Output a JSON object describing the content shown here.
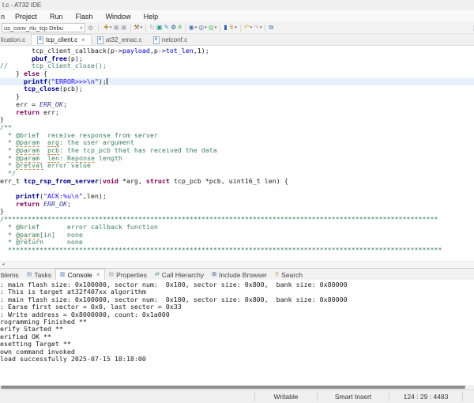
{
  "window": {
    "title": "t.c - AT32 IDE"
  },
  "menu_bar": {
    "items": [
      {
        "label": "n"
      },
      {
        "label": "Project"
      },
      {
        "label": "Run"
      },
      {
        "label": "Flash"
      },
      {
        "label": "Window"
      },
      {
        "label": "Help"
      }
    ]
  },
  "toolbar": {
    "launch_config_label": "us_conv_rtu_tcp Debu",
    "launch_chevron": "∨",
    "launch_gear_glyph": "⚙",
    "icons": [
      {
        "name": "new-wizard-icon",
        "glyph": "✚",
        "color": "#b8923a",
        "dropdown": true
      },
      {
        "name": "save-icon",
        "glyph": "▣",
        "color": "#aeb3b9"
      },
      {
        "name": "save-all-icon",
        "glyph": "▣",
        "color": "#aeb3b9"
      },
      {
        "sep": true
      },
      {
        "name": "build-icon",
        "glyph": "⚒",
        "color": "#8a6d3b",
        "dropdown": true
      },
      {
        "sep": true
      },
      {
        "name": "refresh-icon",
        "glyph": "↻",
        "color": "#aeb3b9"
      },
      {
        "name": "chip-icon",
        "glyph": "▣",
        "color": "#2a9d8f"
      },
      {
        "name": "erase-icon",
        "glyph": "✎",
        "color": "#4a90d9"
      },
      {
        "name": "settings-gear-icon",
        "glyph": "⚙",
        "color": "#2456a4"
      },
      {
        "name": "hash-icon",
        "glyph": "#",
        "color": "#3cb54a"
      },
      {
        "sep": true
      },
      {
        "name": "debug-icon",
        "glyph": "◉",
        "color": "#4a77b4",
        "dropdown": true
      },
      {
        "name": "run-icon",
        "glyph": "◎",
        "color": "#4a77b4",
        "dropdown": true
      },
      {
        "name": "external-tools-icon",
        "glyph": "◎",
        "color": "#3cb54a",
        "dropdown": true
      },
      {
        "sep": true
      },
      {
        "name": "target-board-icon",
        "glyph": "▮",
        "color": "#3a5fa8"
      },
      {
        "name": "flash-download-icon",
        "glyph": "↯",
        "color": "#c49a3c",
        "dropdown": true
      },
      {
        "sep": true
      },
      {
        "name": "back-icon",
        "glyph": "↶",
        "color": "#d6a930",
        "dropdown": true
      },
      {
        "name": "forward-icon",
        "glyph": "↷",
        "color": "#aeb3b9",
        "dropdown": true
      },
      {
        "sep": true
      },
      {
        "name": "perspective-icon",
        "glyph": "⧉",
        "color": "#4a77b4"
      }
    ],
    "right_clipped_icon_glyph": "▮"
  },
  "editor_tabs": [
    {
      "label": "lication.c"
    },
    {
      "label": "tcp_client.c",
      "active": true,
      "close": "×"
    },
    {
      "label": "at32_emac.c"
    },
    {
      "label": "netconf.c"
    }
  ],
  "editor": {
    "cursor_line": 4,
    "lines": [
      {
        "seg": [
          [
            "pl",
            "        tcp_client_callback(p->"
          ],
          [
            "fld",
            "payload"
          ],
          [
            "pl",
            ",p->"
          ],
          [
            "fld",
            "tot_len"
          ],
          [
            "pl",
            ",1);"
          ]
        ]
      },
      {
        "seg": [
          [
            "pl",
            "        "
          ],
          [
            "fnb",
            "pbuf_free"
          ],
          [
            "pl",
            "(p);"
          ]
        ]
      },
      {
        "seg": [
          [
            "cm",
            "//      tcp_client_close();"
          ]
        ]
      },
      {
        "seg": [
          [
            "pl",
            "    } "
          ],
          [
            "kw",
            "else"
          ],
          [
            "pl",
            " {"
          ]
        ]
      },
      {
        "seg": [
          [
            "pl",
            "      "
          ],
          [
            "fnb",
            "printf"
          ],
          [
            "pl",
            "("
          ],
          [
            "str",
            "\"ERROR>>>\\n\""
          ],
          [
            "pl",
            ");"
          ]
        ]
      },
      {
        "seg": [
          [
            "pl",
            "      "
          ],
          [
            "fnb",
            "tcp_close"
          ],
          [
            "pl",
            "(pcb);"
          ]
        ]
      },
      {
        "seg": [
          [
            "pl",
            "    }"
          ]
        ]
      },
      {
        "seg": [
          [
            "pl",
            "    err = "
          ],
          [
            "mac",
            "ERR_OK"
          ],
          [
            "pl",
            ";"
          ]
        ]
      },
      {
        "seg": [
          [
            "pl",
            "    "
          ],
          [
            "kw",
            "return"
          ],
          [
            "pl",
            " err;"
          ]
        ]
      },
      {
        "seg": [
          [
            "pl",
            "}"
          ]
        ]
      },
      {
        "seg": [
          [
            "cm",
            "/**"
          ]
        ]
      },
      {
        "seg": [
          [
            "cm",
            "  * "
          ],
          [
            "cmt",
            "@brief"
          ],
          [
            "cm",
            "  receive response from server"
          ]
        ]
      },
      {
        "seg": [
          [
            "cm",
            "  * "
          ],
          [
            "cmu",
            "@param"
          ],
          [
            "cm",
            "  "
          ],
          [
            "cmu",
            "arg"
          ],
          [
            "cm",
            ": the user argument"
          ]
        ]
      },
      {
        "seg": [
          [
            "cm",
            "  * "
          ],
          [
            "cmu",
            "@param"
          ],
          [
            "cm",
            "  "
          ],
          [
            "cmu",
            "pcb"
          ],
          [
            "cm",
            ": the tcp_pcb that has received the data"
          ]
        ]
      },
      {
        "seg": [
          [
            "cm",
            "  * "
          ],
          [
            "cmu",
            "@param"
          ],
          [
            "cm",
            "  "
          ],
          [
            "cmu",
            "len"
          ],
          [
            "cm",
            ": "
          ],
          [
            "cmu",
            "Reponse"
          ],
          [
            "cm",
            " length"
          ]
        ]
      },
      {
        "seg": [
          [
            "cm",
            "  * "
          ],
          [
            "cmu",
            "@retval"
          ],
          [
            "cm",
            " error value"
          ]
        ]
      },
      {
        "seg": [
          [
            "cm",
            "  */"
          ]
        ]
      },
      {
        "seg": [
          [
            "pl",
            "err_t "
          ],
          [
            "fnb",
            "tcp_rsp_from_server"
          ],
          [
            "pl",
            "("
          ],
          [
            "kw",
            "void"
          ],
          [
            "pl",
            " *arg, "
          ],
          [
            "kw",
            "struct"
          ],
          [
            "pl",
            " tcp_pcb *pcb, uint16_t len) {"
          ]
        ]
      },
      {
        "seg": []
      },
      {
        "seg": [
          [
            "pl",
            "    "
          ],
          [
            "fnb",
            "printf"
          ],
          [
            "pl",
            "("
          ],
          [
            "str",
            "\"ACK:%u\\n\""
          ],
          [
            "pl",
            ",len);"
          ]
        ]
      },
      {
        "seg": [
          [
            "pl",
            "    "
          ],
          [
            "kw",
            "return"
          ],
          [
            "pl",
            " "
          ],
          [
            "mac",
            "ERR_OK"
          ],
          [
            "pl",
            ";"
          ]
        ]
      },
      {
        "seg": [
          [
            "pl",
            "}"
          ]
        ]
      },
      {
        "seg": [
          [
            "cm",
            "/**************************************************************************************************************"
          ]
        ]
      },
      {
        "seg": [
          [
            "cm",
            "  * "
          ],
          [
            "cmt",
            "@brief"
          ],
          [
            "cm",
            "       error callback function"
          ]
        ]
      },
      {
        "seg": [
          [
            "cm",
            "  * "
          ],
          [
            "cmu",
            "@param"
          ],
          [
            "cm",
            "[in]   none"
          ]
        ]
      },
      {
        "seg": [
          [
            "cm",
            "  * "
          ],
          [
            "cmt",
            "@return"
          ],
          [
            "cm",
            "      none"
          ]
        ]
      },
      {
        "seg": [
          [
            "cm",
            "  **************************************************************************************************************"
          ]
        ]
      }
    ]
  },
  "console_panel": {
    "tabs": [
      {
        "label": "blems"
      },
      {
        "label": "Tasks",
        "icon_glyph": "▤",
        "icon_color": "#7d93b2"
      },
      {
        "label": "Console",
        "icon_glyph": "▥",
        "icon_color": "#4a77b4",
        "active": true,
        "close": "×"
      },
      {
        "label": "Properties",
        "icon_glyph": "▤",
        "icon_color": "#9aa0a6"
      },
      {
        "label": "Call Hierarchy",
        "icon_glyph": "⇄",
        "icon_color": "#3f8f6f"
      },
      {
        "label": "Include Browser",
        "icon_glyph": "⊞",
        "icon_color": "#30548f"
      },
      {
        "label": "Search",
        "icon_glyph": "⚲",
        "icon_color": "#c49a3c"
      }
    ],
    "lines": [
      ": main flash size: 0x100000, sector num:  0x100, sector size: 0x800,  bank size: 0x80000",
      ": This is target at32f407xx algorithm",
      ": main flash size: 0x100000, sector num:  0x100, sector size: 0x800,  bank size: 0x80000",
      ": Earse first sector = 0x0, last sector = 0x33",
      ": Write address = 0x8000000, count: 0x1a000",
      "rogramming Finished **",
      "erify Started **",
      "erified OK **",
      "esetting Target **",
      "own command invoked",
      "load successfully 2025-07-15 18:18:00"
    ]
  },
  "status_bar": {
    "writable": "Writable",
    "insert_mode": "Smart Insert",
    "caret_position": "124 : 29 : 4483"
  }
}
